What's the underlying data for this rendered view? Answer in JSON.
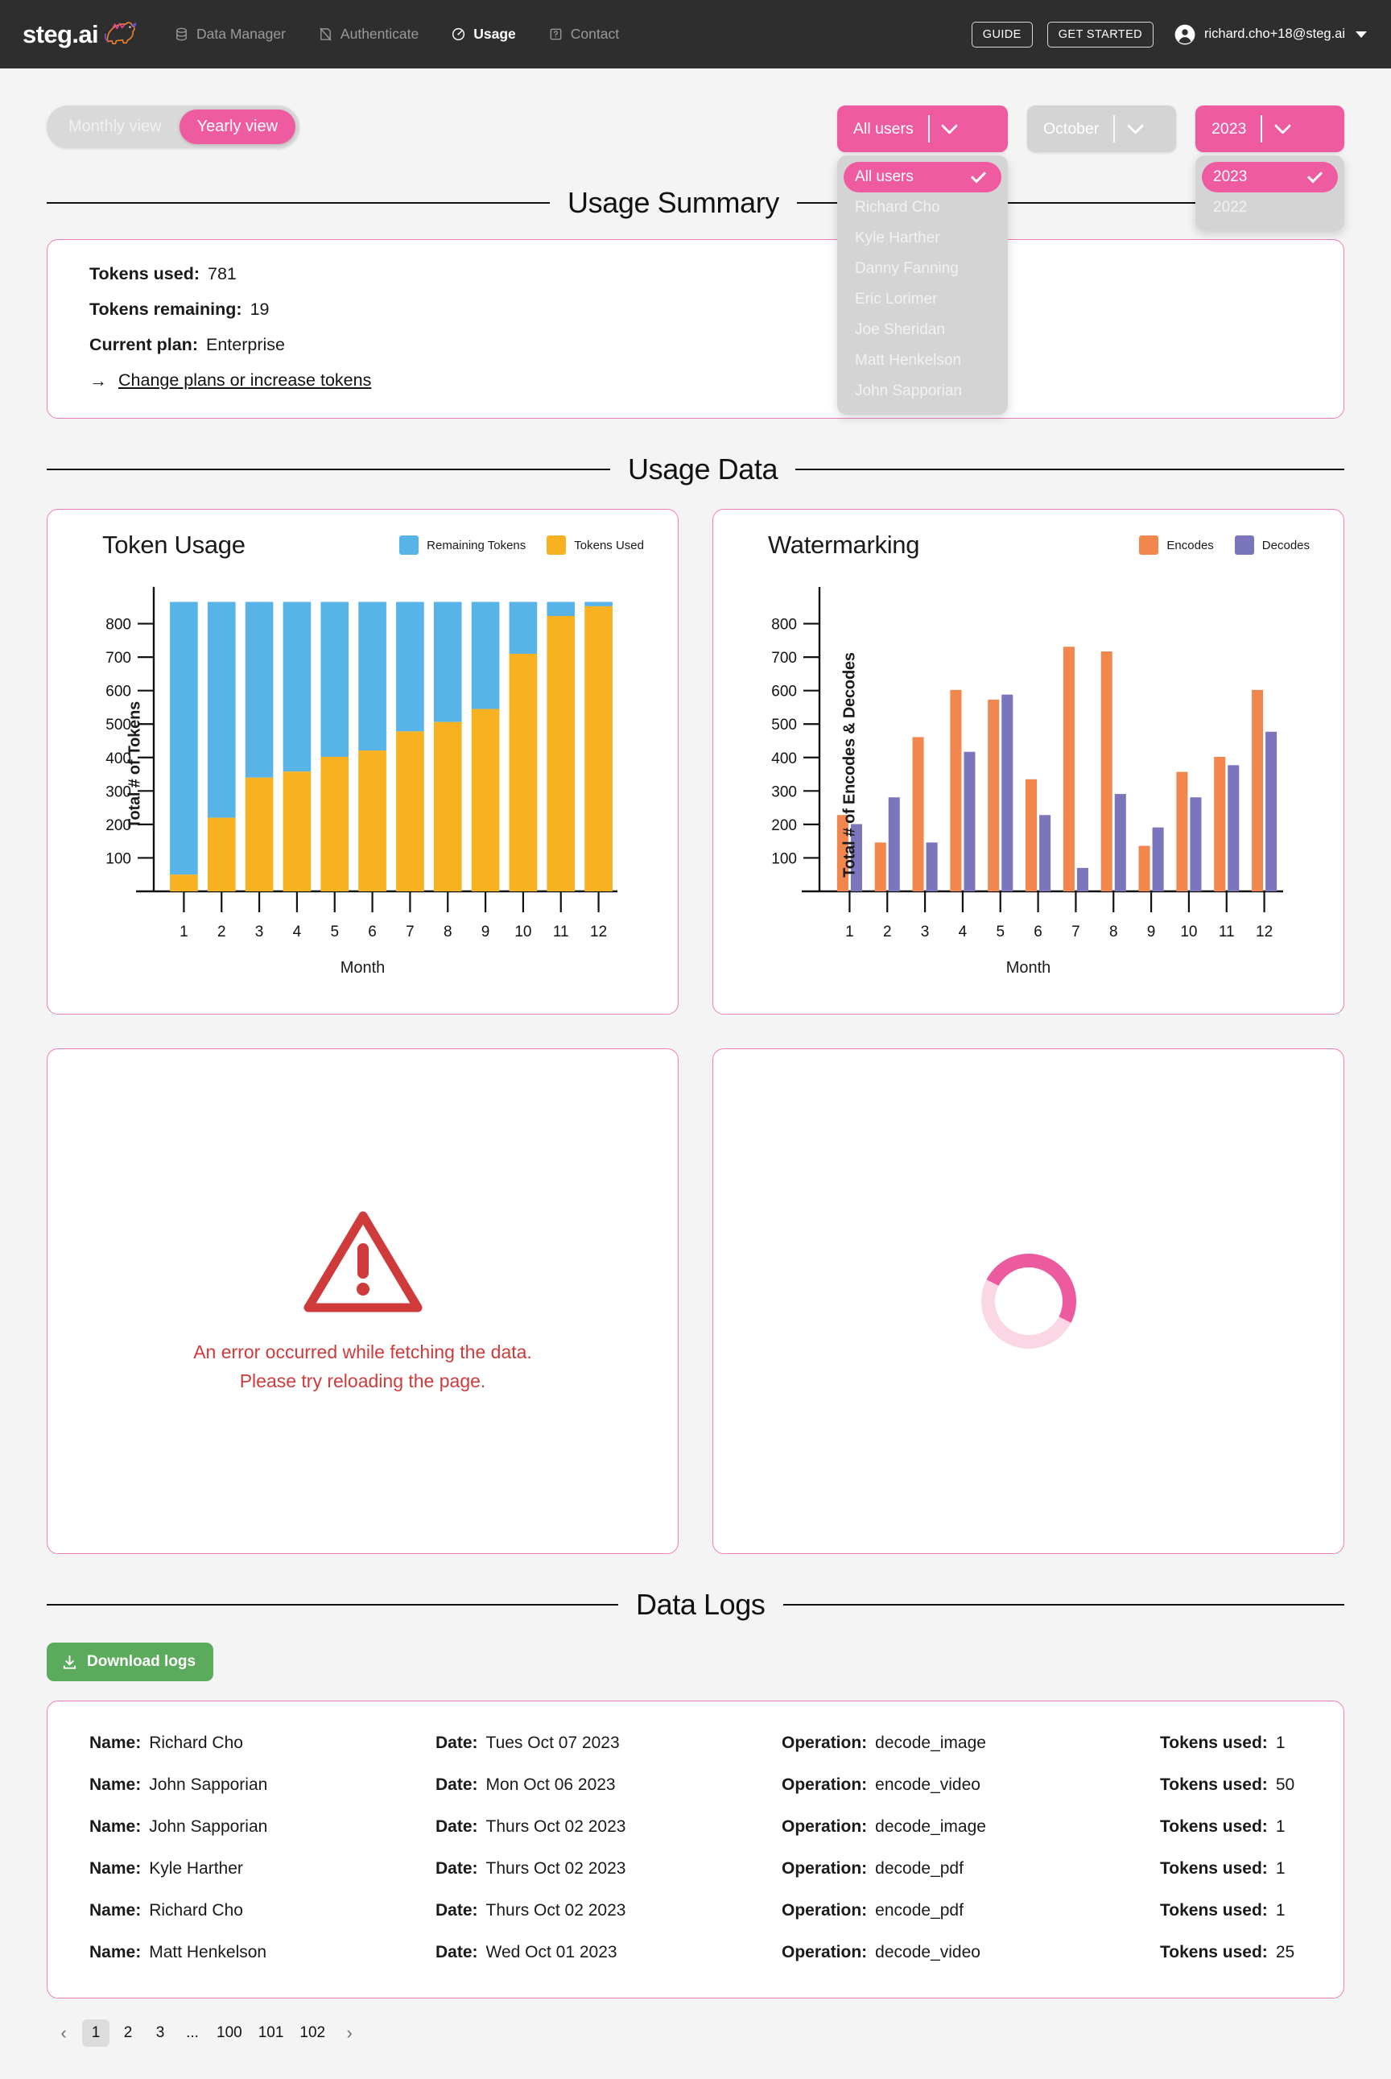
{
  "nav": {
    "brand": "steg.ai",
    "items": [
      {
        "label": "Data Manager",
        "icon": "database-icon",
        "active": false
      },
      {
        "label": "Authenticate",
        "icon": "authenticate-icon",
        "active": false
      },
      {
        "label": "Usage",
        "icon": "gauge-icon",
        "active": true
      },
      {
        "label": "Contact",
        "icon": "help-box-icon",
        "active": false
      }
    ],
    "guide_label": "GUIDE",
    "get_started_label": "GET STARTED",
    "account_email": "richard.cho+18@steg.ai"
  },
  "controls": {
    "monthly_view_label": "Monthly view",
    "yearly_view_label": "Yearly view",
    "active_view": "Yearly view",
    "user_select": {
      "value": "All users",
      "open": true,
      "options": [
        "All users",
        "Richard Cho",
        "Kyle Harther",
        "Danny Fanning",
        "Eric Lorimer",
        "Joe Sheridan",
        "Matt Henkelson",
        "John Sapporian"
      ],
      "selected": "All users"
    },
    "month_select": {
      "value": "October",
      "disabled": true
    },
    "year_select": {
      "value": "2023",
      "open": true,
      "options": [
        "2023",
        "2022"
      ],
      "selected": "2023"
    }
  },
  "sections": {
    "usage_summary": "Usage Summary",
    "usage_data": "Usage Data",
    "data_logs": "Data Logs"
  },
  "summary": {
    "tokens_used_label": "Tokens used:",
    "tokens_used_value": "781",
    "tokens_remaining_label": "Tokens remaining:",
    "tokens_remaining_value": "19",
    "current_plan_label": "Current plan:",
    "current_plan_value": "Enterprise",
    "change_plans_link": "Change plans or increase tokens",
    "arrow_glyph": "→"
  },
  "chart_data": [
    {
      "type": "bar",
      "stacked": true,
      "title": "Token Usage",
      "xlabel": "Month",
      "ylabel": "Total # of Tokens",
      "categories": [
        "1",
        "2",
        "3",
        "4",
        "5",
        "6",
        "7",
        "8",
        "9",
        "10",
        "11",
        "12"
      ],
      "yticks": [
        100,
        200,
        300,
        400,
        500,
        600,
        700,
        800
      ],
      "ylim": [
        0,
        900
      ],
      "grid": false,
      "legend_position": "top-right",
      "series": [
        {
          "name": "Tokens Used",
          "color": "#f7b121",
          "values": [
            50,
            220,
            340,
            358,
            402,
            421,
            478,
            506,
            545,
            710,
            823,
            852
          ]
        },
        {
          "name": "Remaining Tokens",
          "color": "#57b3e8",
          "values": [
            815,
            645,
            525,
            507,
            463,
            444,
            387,
            359,
            320,
            155,
            42,
            13
          ]
        }
      ]
    },
    {
      "type": "bar",
      "stacked": false,
      "title": "Watermarking",
      "xlabel": "Month",
      "ylabel": "Total # of Encodes & Decodes",
      "categories": [
        "1",
        "2",
        "3",
        "4",
        "5",
        "6",
        "7",
        "8",
        "9",
        "10",
        "11",
        "12"
      ],
      "yticks": [
        100,
        200,
        300,
        400,
        500,
        600,
        700,
        800
      ],
      "ylim": [
        0,
        900
      ],
      "grid": false,
      "legend_position": "top-right",
      "series": [
        {
          "name": "Encodes",
          "color": "#f2874e",
          "values": [
            228,
            146,
            461,
            602,
            573,
            335,
            731,
            717,
            136,
            357,
            402,
            602
          ]
        },
        {
          "name": "Decodes",
          "color": "#7b75bb",
          "values": [
            201,
            281,
            146,
            417,
            588,
            228,
            70,
            291,
            191,
            281,
            377,
            477
          ]
        }
      ]
    }
  ],
  "error_panel": {
    "line1": "An error occurred while fetching the data.",
    "line2": "Please try reloading the page."
  },
  "loading_panel": {
    "state": "loading"
  },
  "logs": {
    "download_label": "Download logs",
    "headers": {
      "name": "Name:",
      "date": "Date:",
      "operation": "Operation:",
      "tokens": "Tokens used:"
    },
    "rows": [
      {
        "name": "Richard Cho",
        "date": "Tues Oct 07 2023",
        "operation": "decode_image",
        "tokens": "1"
      },
      {
        "name": "John Sapporian",
        "date": "Mon Oct 06 2023",
        "operation": "encode_video",
        "tokens": "50"
      },
      {
        "name": "John Sapporian",
        "date": "Thurs Oct 02 2023",
        "operation": "decode_image",
        "tokens": "1"
      },
      {
        "name": "Kyle Harther",
        "date": "Thurs Oct 02 2023",
        "operation": "decode_pdf",
        "tokens": "1"
      },
      {
        "name": "Richard Cho",
        "date": "Thurs Oct 02 2023",
        "operation": "encode_pdf",
        "tokens": "1"
      },
      {
        "name": "Matt Henkelson",
        "date": "Wed Oct 01 2023",
        "operation": "decode_video",
        "tokens": "25"
      }
    ]
  },
  "pagination": {
    "prev_glyph": "‹",
    "next_glyph": "›",
    "pages": [
      "1",
      "2",
      "3",
      "...",
      "100",
      "101",
      "102"
    ],
    "current": "1"
  },
  "colors": {
    "brand_pink": "#ef5ba1",
    "card_border": "#ef7eb5",
    "nav_bg": "#2e2e2e",
    "page_bg": "#f4f4f4",
    "green": "#5cab5c",
    "error_red": "#cf3b3b"
  }
}
